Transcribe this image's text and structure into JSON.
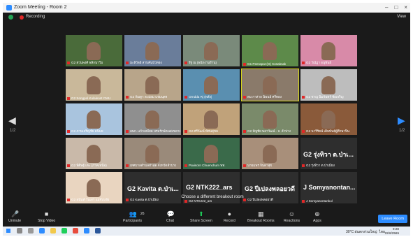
{
  "window": {
    "title": "Zoom Meeting - Room 2"
  },
  "status": {
    "recording": "Recording",
    "view": "View"
  },
  "pager": {
    "left": "1/2",
    "right": "1/2"
  },
  "tiles": [
    {
      "label": "G2 ส่วนพงศ์ พลิกนาวิน",
      "big": ""
    },
    {
      "label": "มะลิวัลย์ สาบค้นบัวทอง",
      "big": ""
    },
    {
      "label": "รัฐ ณ (พนักงานร้าน)",
      "big": ""
    },
    {
      "label": "G1 Peerapat (G) Kosabsak",
      "big": ""
    },
    {
      "label": "G2 วัณ์ฎา อนุพันธ์",
      "big": ""
    },
    {
      "label": "G2 Songpol Kulaleost CMU",
      "big": ""
    },
    {
      "label": "G2 กัณฐา ละม่อม แจ่มนุตร",
      "big": ""
    },
    {
      "label": "Orndda Rj (พลัง)",
      "big": ""
    },
    {
      "label": "ดม กาล่าล นิพนธ์ ศรีทอง",
      "big": ""
    },
    {
      "label": "G2 ชาญ นิ้มจันทร์ ชัยเจริญ",
      "big": ""
    },
    {
      "label": "G2 ภาพเจริญชัย ดนิมย",
      "big": ""
    },
    {
      "label": "อนก. แก้วเหลี่ยม บรมรักษ์คนสงขลาคอ",
      "big": ""
    },
    {
      "label": "G2 ศรีวัฒน์ ทัศนสุขม",
      "big": ""
    },
    {
      "label": "G2 จัญชัย พลาวัฒน์ - จ. ลำปาง",
      "big": ""
    },
    {
      "label": "G2 นารีรัตน์ เดิมพันธุ์ผู้ศึกษาปิ่น",
      "big": ""
    },
    {
      "label": "G2 พิศิษฐ์ เตะ (ภาคเหนือ)",
      "big": ""
    },
    {
      "label": "เทศบาลตำบลท่าสุด จังหวัดลำปาง",
      "big": ""
    },
    {
      "label": "Pavisorn Chuenchum พท.",
      "big": ""
    },
    {
      "label": "นายแพร จินดาสุข",
      "big": ""
    },
    {
      "label": "G2 รุ่งทิวา ต.ป่าเมี่ยง",
      "big": "G2 รุ่งทิวา ต.ป่าเ..."
    },
    {
      "label": "G2 อนันท์ วันเสร แม่จับบจัย",
      "big": ""
    },
    {
      "label": "G2 Kavita ต.ป่าเมี่ยง",
      "big": "G2 Kavita ต.ป่าเ..."
    },
    {
      "label": "G2 NTK222_ars",
      "big": "G2 NTK222_ars"
    },
    {
      "label": "G2 ปีเปลงพลอยวดี",
      "big": "G2 ปีเปลงพลอยวดี"
    },
    {
      "label": "J Somyanontankul",
      "big": "J Somyanontan..."
    }
  ],
  "breakout_msg": "Choose a different breakout room",
  "toolbar": {
    "unmute": "Unmute",
    "stop_video": "Stop Video",
    "participants": "Participants",
    "participants_count": "26",
    "chat": "Chat",
    "share_screen": "Share Screen",
    "record": "Record",
    "breakout": "Breakout Rooms",
    "reactions": "Reactions",
    "apps": "Apps",
    "leave": "Leave Room"
  },
  "taskbar": {
    "temp": "30°C ฝนตกส่วนใหญ่",
    "lang": "ไทย",
    "time": "9:28",
    "date": "22/6/2565"
  },
  "colors": {
    "accent": "#2d8cff",
    "share": "#1fcf5b",
    "rec": "#e02828"
  }
}
